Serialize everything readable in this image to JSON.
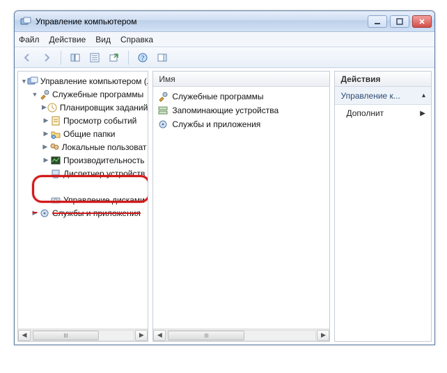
{
  "window": {
    "title": "Управление компьютером"
  },
  "menu": {
    "file": "Файл",
    "action": "Действие",
    "view": "Вид",
    "help": "Справка"
  },
  "tree": {
    "root": "Управление компьютером (л",
    "group_system": "Служебные программы",
    "scheduler": "Планировщик заданий",
    "eventviewer": "Просмотр событий",
    "sharedfolders": "Общие папки",
    "localusers": "Локальные пользоват",
    "performance": "Производительность",
    "devicemgr": "Диспетчер устройств",
    "storage_obscured_top": "",
    "diskmgmt": "Управление дисками",
    "services_obscured": "Службы и приложения"
  },
  "list": {
    "header": "Имя",
    "row1": "Служебные программы",
    "row2": "Запоминающие устройства",
    "row3": "Службы и приложения"
  },
  "actions": {
    "header": "Действия",
    "primary": "Управление к...",
    "more": "Дополнит"
  }
}
